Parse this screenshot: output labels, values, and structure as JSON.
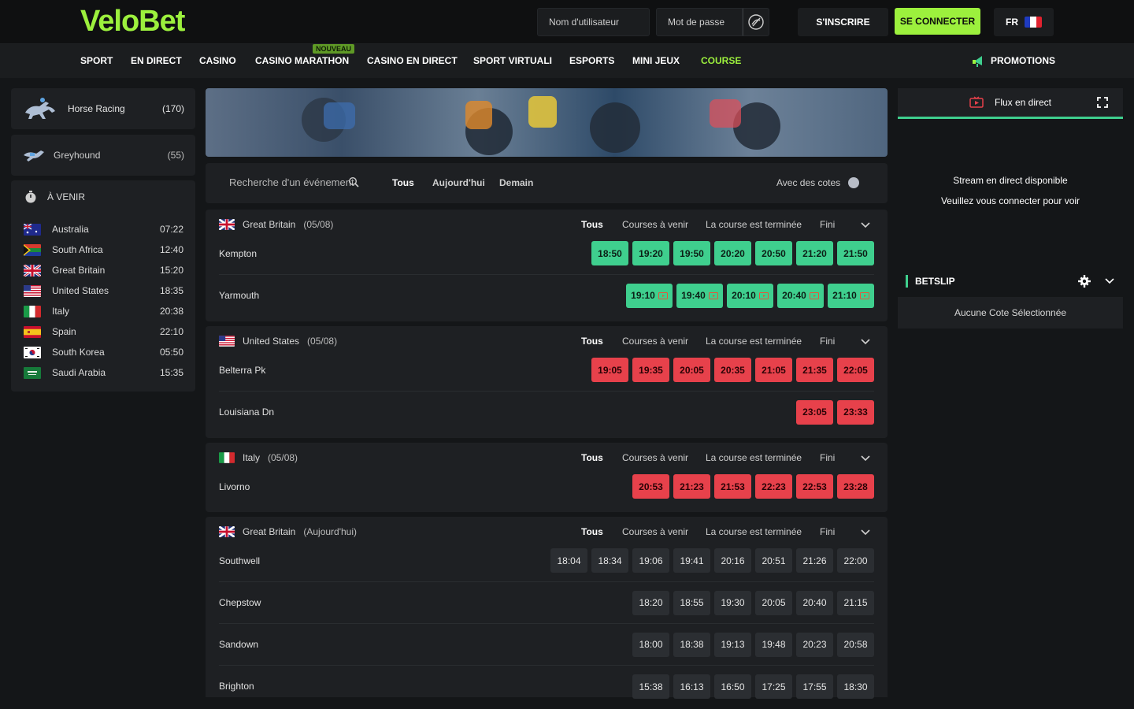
{
  "header": {
    "logo": "VeloBet",
    "username_placeholder": "Nom d'utilisateur",
    "password_placeholder": "Mot de passe",
    "register_label": "S'INSCRIRE",
    "login_label": "SE CONNECTER",
    "language": "FR",
    "accent_color": "#9cf03d"
  },
  "nav": {
    "items": [
      "SPORT",
      "EN DIRECT",
      "CASINO",
      "CASINO MARATHON",
      "CASINO EN DIRECT",
      "SPORT VIRTUALI",
      "ESPORTS",
      "MINI JEUX",
      "COURSE"
    ],
    "active": "COURSE",
    "new_badge": "NOUVEAU",
    "promotions": "PROMOTIONS"
  },
  "sidebar": {
    "sports": [
      {
        "name": "Horse Racing",
        "count": "(170)",
        "icon": "horse-racing-icon"
      },
      {
        "name": "Greyhound",
        "count": "(55)",
        "icon": "greyhound-icon"
      }
    ],
    "upcoming_title": "À VENIR",
    "upcoming": [
      {
        "country": "Australia",
        "time": "07:22"
      },
      {
        "country": "South Africa",
        "time": "12:40"
      },
      {
        "country": "Great Britain",
        "time": "15:20"
      },
      {
        "country": "United States",
        "time": "18:35"
      },
      {
        "country": "Italy",
        "time": "20:38"
      },
      {
        "country": "Spain",
        "time": "22:10"
      },
      {
        "country": "South Korea",
        "time": "05:50"
      },
      {
        "country": "Saudi Arabia",
        "time": "15:35"
      }
    ]
  },
  "filters": {
    "search_placeholder": "Recherche d'un événement",
    "tabs": [
      "Tous",
      "Aujourd'hui",
      "Demain"
    ],
    "odds_toggle_label": "Avec des cotes"
  },
  "block_tabs": [
    "Tous",
    "Courses à venir",
    "La course est terminée",
    "Fini"
  ],
  "blocks": [
    {
      "country": "Great Britain",
      "date": "(05/08)",
      "races": [
        {
          "name": "Kempton",
          "times": [
            "18:50",
            "19:20",
            "19:50",
            "20:20",
            "20:50",
            "21:20",
            "21:50"
          ],
          "status": "green",
          "stream": false
        },
        {
          "name": "Yarmouth",
          "times": [
            "19:10",
            "19:40",
            "20:10",
            "20:40",
            "21:10"
          ],
          "status": "green",
          "stream": true
        }
      ]
    },
    {
      "country": "United States",
      "date": "(05/08)",
      "races": [
        {
          "name": "Belterra Pk",
          "times": [
            "19:05",
            "19:35",
            "20:05",
            "20:35",
            "21:05",
            "21:35",
            "22:05"
          ],
          "status": "red",
          "stream": false
        },
        {
          "name": "Louisiana Dn",
          "times": [
            "23:05",
            "23:33"
          ],
          "status": "red",
          "stream": false
        }
      ]
    },
    {
      "country": "Italy",
      "date": "(05/08)",
      "races": [
        {
          "name": "Livorno",
          "times": [
            "20:53",
            "21:23",
            "21:53",
            "22:23",
            "22:53",
            "23:28"
          ],
          "status": "red",
          "stream": false
        }
      ]
    },
    {
      "country": "Great Britain",
      "date": "(Aujourd'hui)",
      "races": [
        {
          "name": "Southwell",
          "times": [
            "18:04",
            "18:34",
            "19:06",
            "19:41",
            "20:16",
            "20:51",
            "21:26",
            "22:00"
          ],
          "status": "dark",
          "stream": false
        },
        {
          "name": "Chepstow",
          "times": [
            "18:20",
            "18:55",
            "19:30",
            "20:05",
            "20:40",
            "21:15"
          ],
          "status": "dark",
          "stream": false
        },
        {
          "name": "Sandown",
          "times": [
            "18:00",
            "18:38",
            "19:13",
            "19:48",
            "20:23",
            "20:58"
          ],
          "status": "dark",
          "stream": false
        },
        {
          "name": "Brighton",
          "times": [
            "15:38",
            "16:13",
            "16:50",
            "17:25",
            "17:55",
            "18:30"
          ],
          "status": "dark",
          "stream": false
        }
      ]
    }
  ],
  "right": {
    "stream_title": "Flux en direct",
    "stream_msg_1": "Stream en direct disponible",
    "stream_msg_2": "Veuillez vous connecter pour voir",
    "betslip_title": "BETSLIP",
    "betslip_empty": "Aucune Cote Sélectionnée"
  }
}
